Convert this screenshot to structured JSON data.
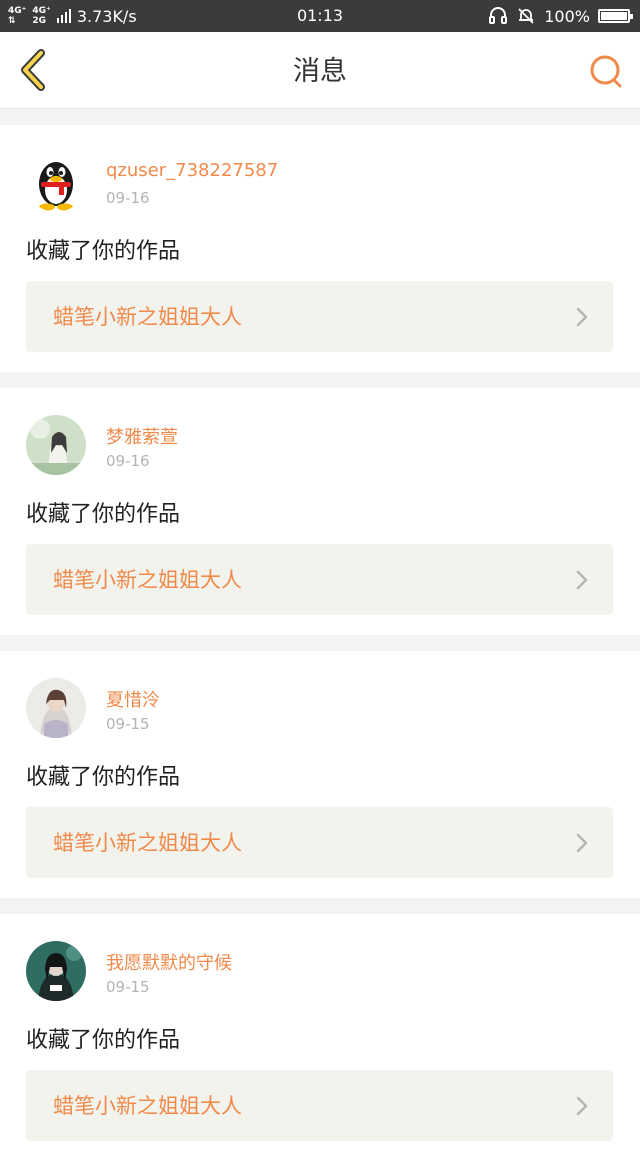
{
  "status_bar": {
    "network_1": "4G⁺",
    "network_2": "4G⁺",
    "network_3": "2G",
    "speed": "3.73K/s",
    "time": "01:13",
    "battery": "100%",
    "battery_level": 1.0,
    "icons": [
      "headset-icon",
      "bell-muted-icon",
      "battery-icon"
    ]
  },
  "nav": {
    "title": "消息",
    "back_icon": "chevron-left-icon",
    "search_icon": "search-icon",
    "accent": "#f08a4b",
    "back_color": "#f5d44b"
  },
  "messages": [
    {
      "username": "qzuser_738227587",
      "date": "09-16",
      "action": "收藏了你的作品",
      "work_title": "蜡笔小新之姐姐大人",
      "avatar": "qq-penguin-avatar"
    },
    {
      "username": "梦雅萦萱",
      "date": "09-16",
      "action": "收藏了你的作品",
      "work_title": "蜡笔小新之姐姐大人",
      "avatar": "photo-avatar"
    },
    {
      "username": "夏惜泠",
      "date": "09-15",
      "action": "收藏了你的作品",
      "work_title": "蜡笔小新之姐姐大人",
      "avatar": "photo-avatar"
    },
    {
      "username": "我愿默默的守候",
      "date": "09-15",
      "action": "收藏了你的作品",
      "work_title": "蜡笔小新之姐姐大人",
      "avatar": "photo-avatar"
    }
  ]
}
